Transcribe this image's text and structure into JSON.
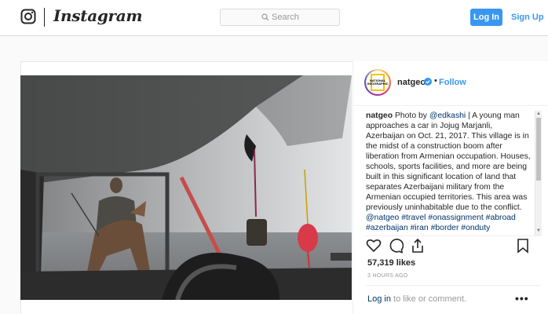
{
  "header": {
    "logo_icon": "instagram-glyph-icon",
    "wordmark": "Instagram",
    "search_placeholder": "Search",
    "login_label": "Log In",
    "signup_label": "Sign Up",
    "accent_color": "#3897f0"
  },
  "post": {
    "username": "natgeo",
    "verified_icon": "verified-badge-icon",
    "dot": "•",
    "follow_label": "Follow",
    "avatar_text": "NATIONAL GEOGRAPHIC",
    "caption": {
      "username": "natgeo",
      "text_1": " Photo by ",
      "mention_1": "@edkashi",
      "text_2": " | A young man approaches a car in Jojug Marjanli, Azerbaijan on Oct. 21, 2017. This village is in the midst of a construction boom after liberation from Armenian occupation. Houses, schools, sports facilities, and more are being built in this significant location of land that separates Azerbaijani military from the Armenian occupied territories. This area was previously uninhabitable due to the conflict. ",
      "mention_2": "@natgeo",
      "text_3": " ",
      "hashtags": "#travel #onassignment #abroad #azerbaijan #iran #border #onduty"
    },
    "likes": "57,319 likes",
    "timestamp": "3 HOURS AGO",
    "comment_login": "Log in",
    "comment_rest": " to like or comment.",
    "more_label": "•••"
  }
}
